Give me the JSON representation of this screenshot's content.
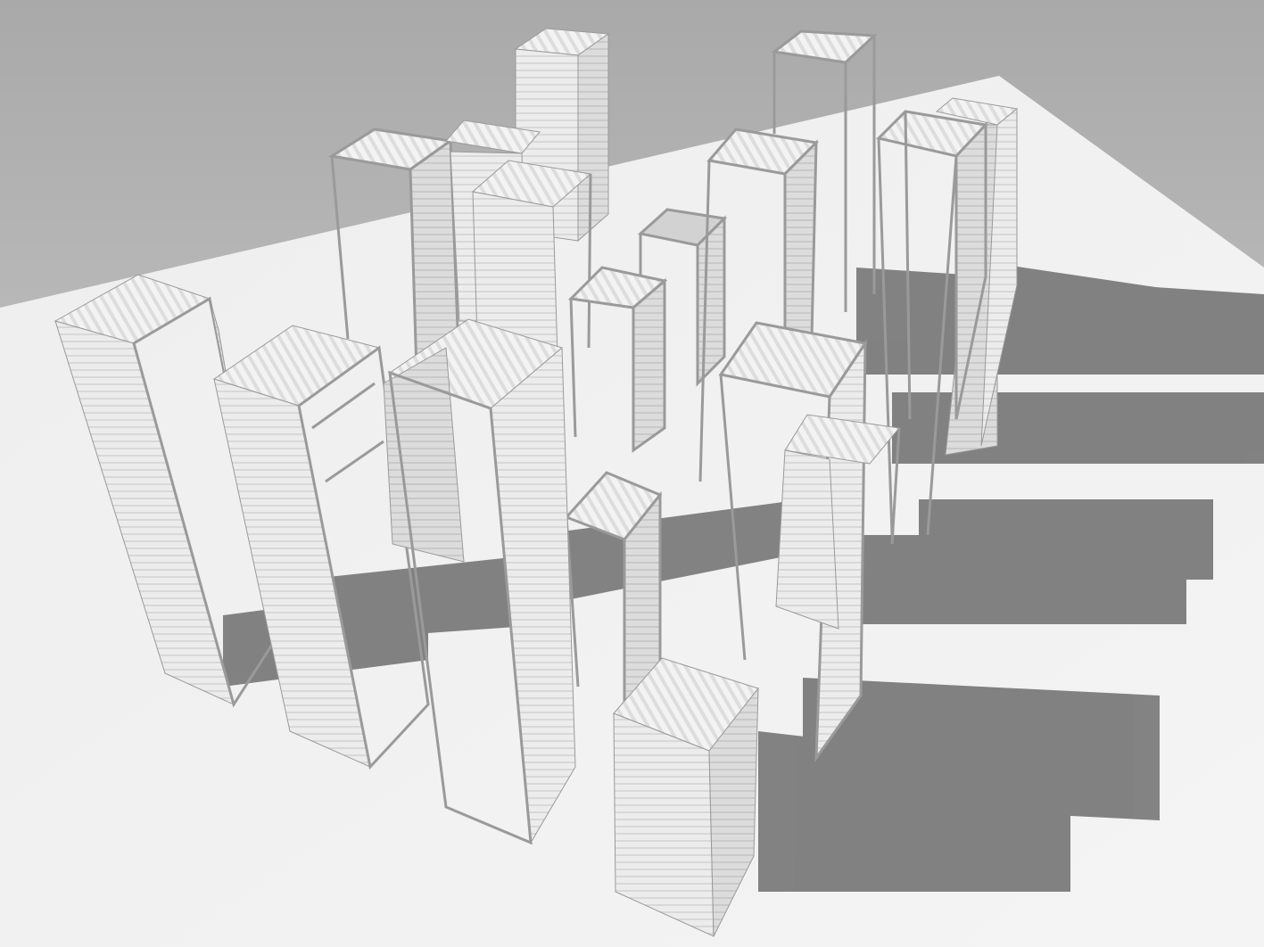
{
  "image": {
    "caption": "",
    "subject": "architectural-model-render",
    "scene": "vertical-shipping-container-towers",
    "colors": {
      "background_top": "#a9a9a9",
      "background_bottom": "#d6d6d6",
      "ground": "#f2f2f2",
      "shadow": "#6e6e6e",
      "container_light": "#f7f7f7",
      "container_mid": "#e3e3e3",
      "container_dark": "#cfcfcf",
      "frame_edge": "#9a9a9a"
    },
    "elements": [
      {
        "name": "container-solid-far-center",
        "kind": "solid"
      },
      {
        "name": "container-frame-far-right",
        "kind": "frame"
      },
      {
        "name": "container-frame-back-left",
        "kind": "frame"
      },
      {
        "name": "container-solid-back-left-2",
        "kind": "solid"
      },
      {
        "name": "container-solid-back-mid",
        "kind": "solid"
      },
      {
        "name": "container-frame-center-small",
        "kind": "frame"
      },
      {
        "name": "container-frame-center-short",
        "kind": "frame"
      },
      {
        "name": "container-frame-mid-right",
        "kind": "frame"
      },
      {
        "name": "container-frame-right-tall",
        "kind": "frame"
      },
      {
        "name": "container-solid-right-back",
        "kind": "solid"
      },
      {
        "name": "container-solid-front-left",
        "kind": "solid"
      },
      {
        "name": "container-solid-front-left-2",
        "kind": "solid"
      },
      {
        "name": "container-solid-front-center",
        "kind": "solid"
      },
      {
        "name": "container-frame-front-mid",
        "kind": "frame"
      },
      {
        "name": "container-frame-front-right",
        "kind": "frame"
      },
      {
        "name": "container-solid-right-small",
        "kind": "solid"
      },
      {
        "name": "container-solid-front-bottom",
        "kind": "solid"
      }
    ]
  }
}
